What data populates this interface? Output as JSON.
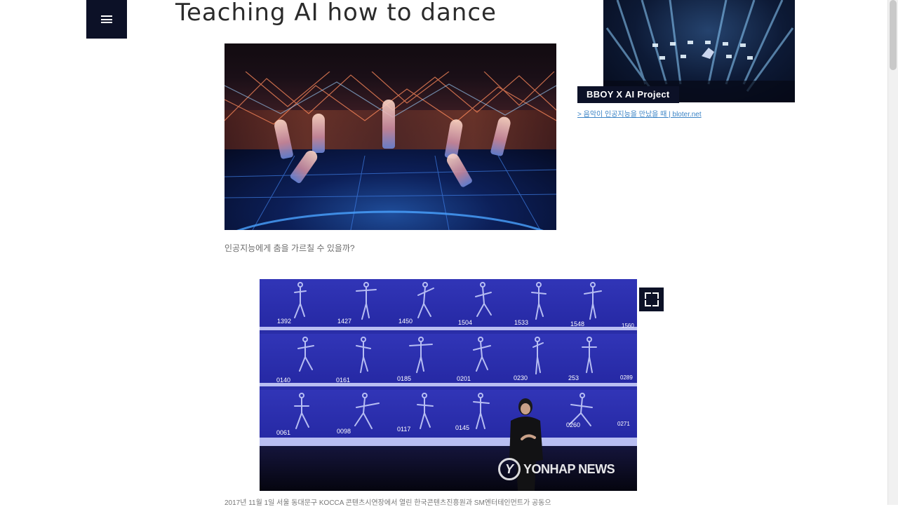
{
  "page": {
    "title": "Teaching AI how to dance",
    "menu_icon": "hamburger-menu-icon"
  },
  "main_image": {
    "caption": "인공지능에게 춤을 가르칠 수 있을까?"
  },
  "side_card": {
    "label": "BBOY X AI Project",
    "link_text": "> 음악이 인공지능을 만났을 때 | bloter.net",
    "link_color": "#3b84c6"
  },
  "motion_image": {
    "frame_numbers": [
      [
        "1392",
        "1427",
        "1450",
        "1504",
        "1533",
        "1548",
        "1560"
      ],
      [
        "0140",
        "0161",
        "0185",
        "0201",
        "0230",
        "253",
        "0289"
      ],
      [
        "0061",
        "0098",
        "0117",
        "0145",
        "0260",
        "0271"
      ]
    ],
    "watermark_text": "YONHAP NEWS",
    "expand_icon": "expand-icon",
    "caption": "2017년 11월 1일 서울 동대문구 KOCCA 콘텐츠시연장에서 열린 한국콘텐츠진흥원과 SM엔터테인먼트가 공동으"
  },
  "colors": {
    "dark_navy": "#0c1127",
    "title_text": "#2b2b2b",
    "caption_text": "#6d6d6d"
  }
}
